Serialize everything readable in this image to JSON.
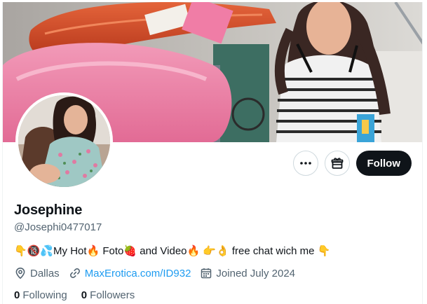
{
  "profile": {
    "name": "Josephine",
    "handle": "@Josephi0477017",
    "bio": "👇🔞💦My Hot🔥 Foto🍓 and Video🔥 👉👌 free chat wich me 👇",
    "location": "Dallas",
    "website": "MaxErotica.com/ID932",
    "joined": "Joined July 2024"
  },
  "actions": {
    "more_icon": "more-icon",
    "subscribe_icon": "gift-icon",
    "follow_label": "Follow"
  },
  "counts": {
    "following_value": "0",
    "following_label": "Following",
    "followers_value": "0",
    "followers_label": "Followers"
  },
  "colors": {
    "accent_link": "#1d9bf0",
    "follow_bg": "#0f1419",
    "secondary_text": "#536471"
  }
}
